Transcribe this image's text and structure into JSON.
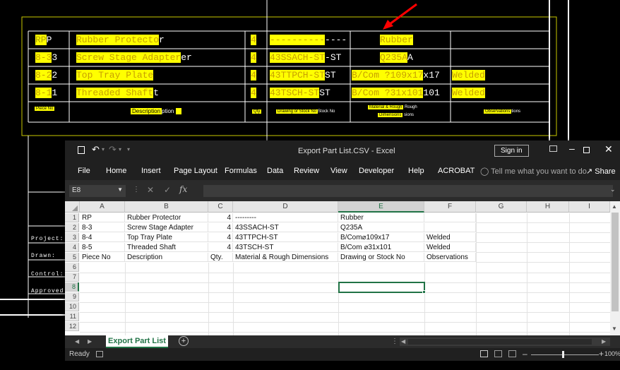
{
  "cad": {
    "rows": [
      {
        "piece_hl": "RP",
        "piece_rest": "P",
        "desc_hl": "Rubber Protecto",
        "desc_rest": "r",
        "qty": "4",
        "stock_hl": "----------",
        "stock_rest": "----",
        "material_hl": "Rubber",
        "material_rest": "",
        "obs": ""
      },
      {
        "piece_hl": "8-3",
        "piece_rest": "3",
        "desc_hl": "Screw Stage Adapter",
        "desc_rest": "er",
        "qty": "4",
        "stock_hl": "43SSACH-ST",
        "stock_rest": "-ST",
        "material_hl": "Q235A",
        "material_rest": "A",
        "obs": ""
      },
      {
        "piece_hl": "8-2",
        "piece_rest": "2",
        "desc_hl": "Top Tray Plate",
        "desc_rest": "",
        "qty": "4",
        "stock_hl": "43TTPCH-ST",
        "stock_rest": "ST",
        "material_hl": "B/Com ?109x17",
        "material_rest": "x17",
        "obs": "Welded"
      },
      {
        "piece_hl": "8-1",
        "piece_rest": "1",
        "desc_hl": "Threaded Shaft",
        "desc_rest": "t",
        "qty": "4",
        "stock_hl": "43TSCH-ST",
        "stock_rest": "ST",
        "material_hl": "B/Com ?31x101",
        "material_rest": "101",
        "obs": "Welded"
      }
    ],
    "header": {
      "piece": "Piece No",
      "desc_hl": "Description",
      "desc_rest": "ption",
      "qty": "Qty",
      "stock_hl": "Drawing or Stock No",
      "stock_rest": "Stock No",
      "material_hl": "Material & Rough",
      "material_rest": "Rough",
      "material_line2_hl": "Dimensions",
      "material_line2_rest": "sions",
      "obs_hl": "Observations",
      "obs_rest": "tions"
    },
    "side_labels": [
      "Project:",
      "Drawn:",
      "Control:",
      "Approved"
    ]
  },
  "excel": {
    "title": "Export Part List.CSV  -  Excel",
    "signin": "Sign in",
    "ribbon_tabs": [
      "File",
      "Home",
      "Insert",
      "Page Layout",
      "Formulas",
      "Data",
      "Review",
      "View",
      "Developer",
      "Help",
      "ACROBAT"
    ],
    "tell_me": "Tell me what you want to do",
    "share": "Share",
    "namebox": "E8",
    "columns": [
      "A",
      "B",
      "C",
      "D",
      "E",
      "F",
      "G",
      "H",
      "I"
    ],
    "row_numbers": [
      "1",
      "2",
      "3",
      "4",
      "5",
      "6",
      "7",
      "8",
      "9",
      "10",
      "11",
      "12"
    ],
    "rows": [
      [
        "RP",
        "Rubber Protector",
        "4",
        "---------",
        "Rubber",
        ""
      ],
      [
        "8-3",
        "Screw Stage Adapter",
        "4",
        "43SSACH-ST",
        "Q235A",
        ""
      ],
      [
        "8-4",
        "Top Tray Plate",
        "4",
        "43TTPCH-ST",
        "B/Com⌀109x17",
        "Welded"
      ],
      [
        "8-5",
        "Threaded Shaft",
        "4",
        "43TSCH-ST",
        "B/Com ⌀31x101",
        "Welded"
      ],
      [
        "Piece No",
        "Description",
        "Qty.",
        "Material & Rough Dimensions",
        "Drawing or Stock No",
        "Observations"
      ]
    ],
    "sheet_tab": "Export Part List",
    "status": "Ready",
    "zoom": "100%",
    "selected_cell": "E8"
  },
  "colors": {
    "highlight": "#ffff00",
    "excel_green": "#217346",
    "arrow": "#ff0000"
  }
}
